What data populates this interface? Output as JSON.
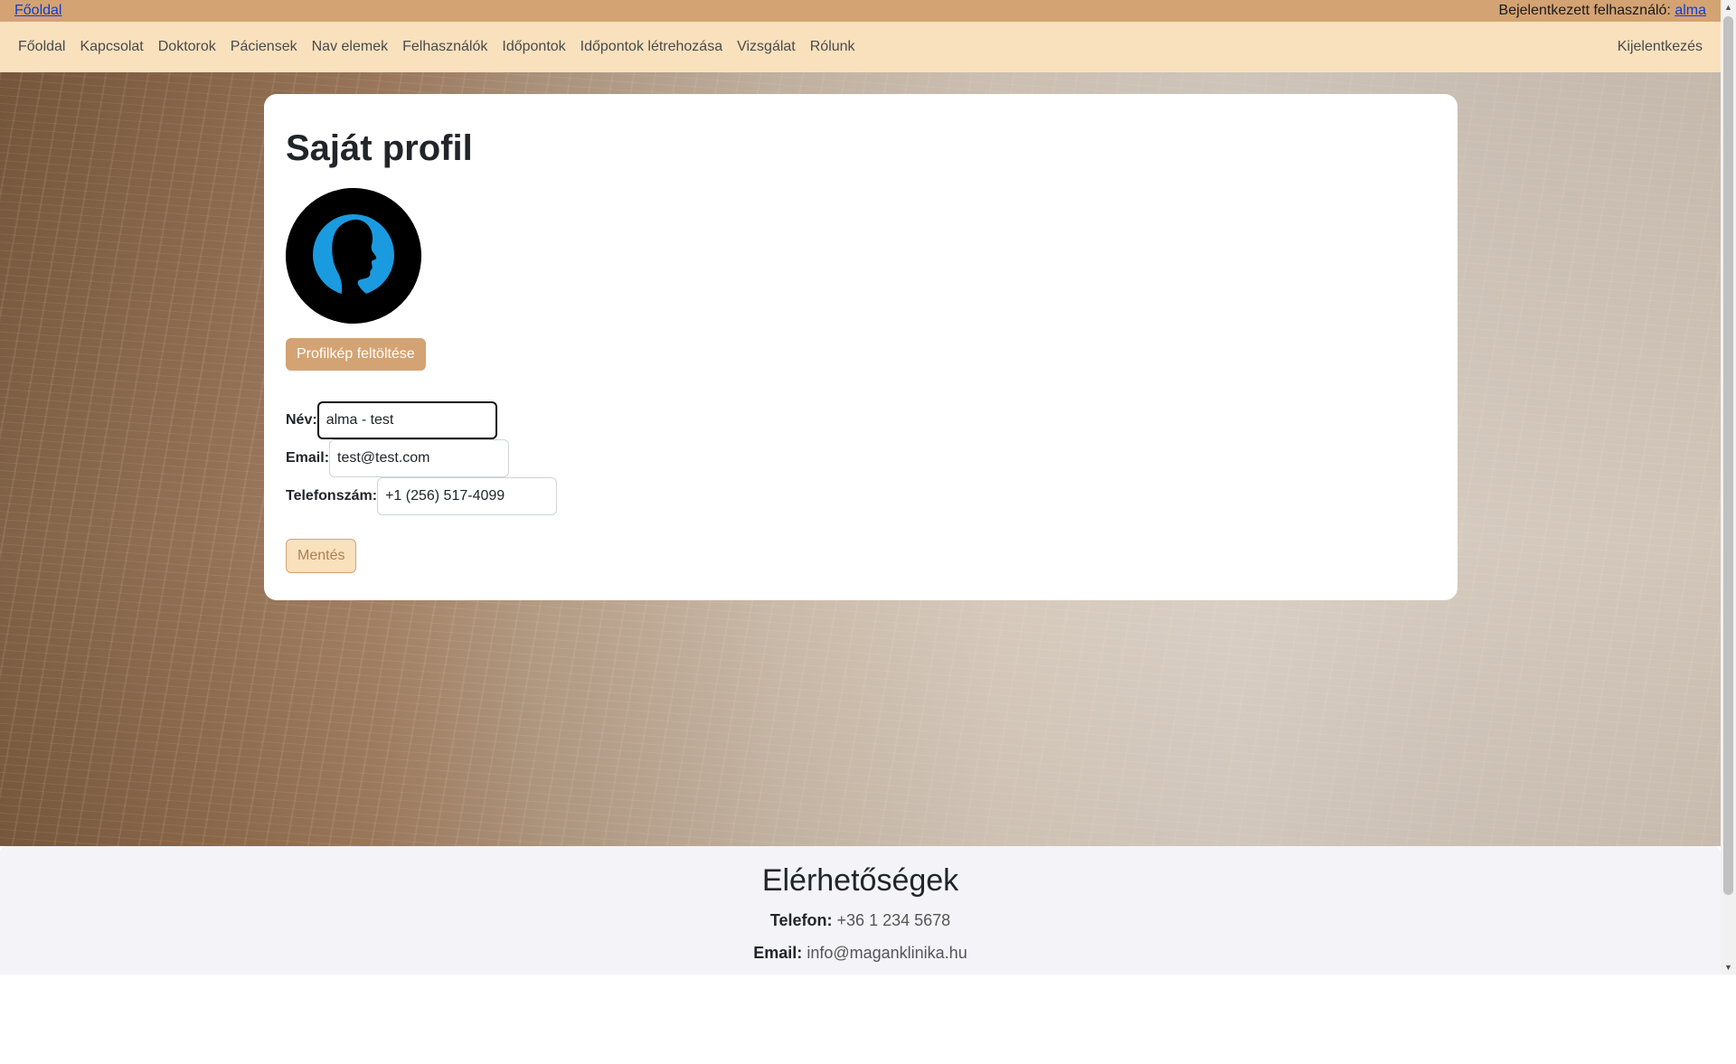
{
  "topbar": {
    "home_link": "Főoldal",
    "login_label": "Bejelentkezett felhasználó:",
    "username": "alma"
  },
  "nav": {
    "items": [
      "Főoldal",
      "Kapcsolat",
      "Doktorok",
      "Páciensek",
      "Nav elemek",
      "Felhasználók",
      "Időpontok",
      "Időpontok létrehozása",
      "Vizsgálat",
      "Rólunk"
    ],
    "logout": "Kijelentkezés"
  },
  "profile": {
    "title": "Saját profil",
    "upload_button": "Profilkép feltöltése",
    "fields": {
      "name_label": "Név:",
      "name_value": "alma - test",
      "email_label": "Email:",
      "email_value": "test@test.com",
      "phone_label": "Telefonszám:",
      "phone_value": "+1 (256) 517-4099"
    },
    "save_button": "Mentés"
  },
  "footer": {
    "title": "Elérhetőségek",
    "phone_label": "Telefon:",
    "phone_value": "+36 1 234 5678",
    "email_label": "Email:",
    "email_value": "info@maganklinika.hu"
  },
  "colors": {
    "topbar": "#d4a373",
    "navbar": "#f9e1bd",
    "accent": "#d4a373",
    "footer": "#f4f3f7"
  }
}
